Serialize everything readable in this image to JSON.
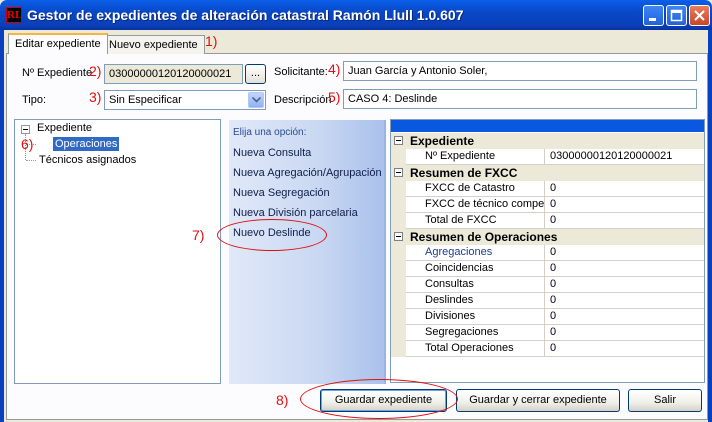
{
  "window": {
    "title": "Gestor de expedientes de alteración catastral Ramón Llull 1.0.607",
    "icon_letter": "RL"
  },
  "tabs": [
    {
      "label": "Editar expediente",
      "active": true
    },
    {
      "label": "Nuevo expediente",
      "active": false
    }
  ],
  "annotations": {
    "a1": "1)",
    "a2": "2)",
    "a3": "3)",
    "a4": "4)",
    "a5": "5)",
    "a6": "6)",
    "a7": "7)",
    "a8": "8)"
  },
  "form": {
    "expediente_label": "Nº Expediente",
    "expediente_value": "03000000120120000021",
    "browse_label": "...",
    "solicitante_label": "Solicitante:",
    "solicitante_value": "Juan García y Antonio Soler,",
    "tipo_label": "Tipo:",
    "tipo_value": "Sin Especificar",
    "descripcion_label": "Descripción",
    "descripcion_value": "CASO 4: Deslinde"
  },
  "tree": {
    "root": "Expediente",
    "items": [
      "Operaciones",
      "Técnicos asignados"
    ],
    "selected": "Operaciones"
  },
  "options": {
    "header": "Elija una opción:",
    "items": [
      "Nueva Consulta",
      "Nueva Agregación/Agrupación",
      "Nueva Segregación",
      "Nueva División parcelaria",
      "Nuevo Deslinde"
    ]
  },
  "properties": {
    "cat1": "Expediente",
    "expediente_key": "Nº Expediente",
    "expediente_val": "03000000120120000021",
    "cat2": "Resumen de FXCC",
    "fxcc": [
      {
        "key": "FXCC de Catastro",
        "val": "0"
      },
      {
        "key": "FXCC de técnico competente",
        "val": "0"
      },
      {
        "key": "Total de FXCC",
        "val": "0"
      }
    ],
    "cat3": "Resumen de Operaciones",
    "ops": [
      {
        "key": "Agregaciones",
        "val": "0"
      },
      {
        "key": "Coincidencias",
        "val": "0"
      },
      {
        "key": "Consultas",
        "val": "0"
      },
      {
        "key": "Deslindes",
        "val": "0"
      },
      {
        "key": "Divisiones",
        "val": "0"
      },
      {
        "key": "Segregaciones",
        "val": "0"
      },
      {
        "key": "Total Operaciones",
        "val": "0"
      }
    ]
  },
  "buttons": {
    "guardar": "Guardar expediente",
    "guardar_cerrar": "Guardar y cerrar expediente",
    "salir": "Salir"
  },
  "colors": {
    "titlebar": "#0848C8",
    "annotation": "#E01010",
    "selection": "#316AC5"
  }
}
